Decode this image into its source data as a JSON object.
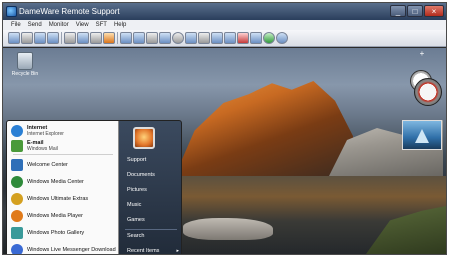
{
  "window": {
    "title": "DameWare Remote Support",
    "buttons": {
      "minimize": "_",
      "maximize": "□",
      "close": "×"
    }
  },
  "menu": [
    "File",
    "Send",
    "Monitor",
    "View",
    "SFT",
    "Help"
  ],
  "toolbar": {
    "icons": [
      "connect-icon",
      "disconnect-icon",
      "screen-icon",
      "move-icon",
      "users-icon",
      "keyboard-icon",
      "chat-icon",
      "remote-icon",
      "monitor-icon",
      "scale-icon",
      "grid-icon",
      "options-icon",
      "refresh-icon",
      "zoom-icon",
      "capture-icon",
      "tools-icon",
      "transfer-icon",
      "close-icon",
      "settings-icon",
      "info-icon",
      "help-icon"
    ]
  },
  "desktop": {
    "recycle_bin_label": "Recycle Bin",
    "gadget_plus": "+"
  },
  "start_menu": {
    "pinned": [
      {
        "title": "Internet",
        "sub": "Internet Explorer",
        "icon": "internet-explorer-icon",
        "color": "#2a7fd4"
      },
      {
        "title": "E-mail",
        "sub": "Windows Mail",
        "icon": "mail-icon",
        "color": "#4a9a3a"
      }
    ],
    "programs": [
      {
        "label": "Welcome Center",
        "icon": "welcome-center-icon",
        "color": "#2f6fb8"
      },
      {
        "label": "Windows Media Center",
        "icon": "media-center-icon",
        "color": "#2e8a3a"
      },
      {
        "label": "Windows Ultimate Extras",
        "icon": "ultimate-extras-icon",
        "color": "#d4a020"
      },
      {
        "label": "Windows Media Player",
        "icon": "media-player-icon",
        "color": "#e07a1a"
      },
      {
        "label": "Windows Photo Gallery",
        "icon": "photo-gallery-icon",
        "color": "#3a9a9a"
      },
      {
        "label": "Windows Live Messenger Download",
        "icon": "messenger-icon",
        "color": "#3a6ad4"
      }
    ],
    "right_items": [
      "Support",
      "Documents",
      "Pictures",
      "Music",
      "Games",
      "Search",
      "Recent Items"
    ],
    "recent_arrow": "▸"
  }
}
